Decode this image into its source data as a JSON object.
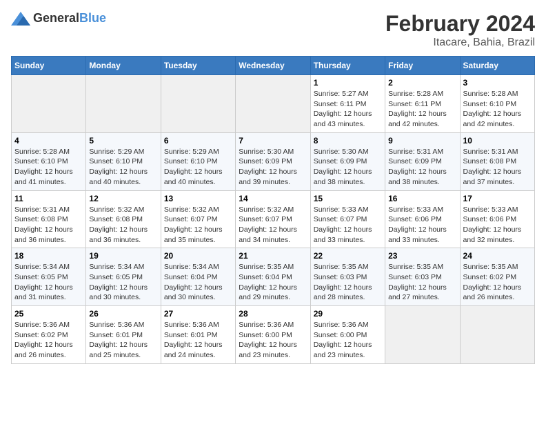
{
  "logo": {
    "general": "General",
    "blue": "Blue"
  },
  "title": "February 2024",
  "location": "Itacare, Bahia, Brazil",
  "days_of_week": [
    "Sunday",
    "Monday",
    "Tuesday",
    "Wednesday",
    "Thursday",
    "Friday",
    "Saturday"
  ],
  "weeks": [
    [
      {
        "day": "",
        "info": ""
      },
      {
        "day": "",
        "info": ""
      },
      {
        "day": "",
        "info": ""
      },
      {
        "day": "",
        "info": ""
      },
      {
        "day": "1",
        "info": "Sunrise: 5:27 AM\nSunset: 6:11 PM\nDaylight: 12 hours and 43 minutes."
      },
      {
        "day": "2",
        "info": "Sunrise: 5:28 AM\nSunset: 6:11 PM\nDaylight: 12 hours and 42 minutes."
      },
      {
        "day": "3",
        "info": "Sunrise: 5:28 AM\nSunset: 6:10 PM\nDaylight: 12 hours and 42 minutes."
      }
    ],
    [
      {
        "day": "4",
        "info": "Sunrise: 5:28 AM\nSunset: 6:10 PM\nDaylight: 12 hours and 41 minutes."
      },
      {
        "day": "5",
        "info": "Sunrise: 5:29 AM\nSunset: 6:10 PM\nDaylight: 12 hours and 40 minutes."
      },
      {
        "day": "6",
        "info": "Sunrise: 5:29 AM\nSunset: 6:10 PM\nDaylight: 12 hours and 40 minutes."
      },
      {
        "day": "7",
        "info": "Sunrise: 5:30 AM\nSunset: 6:09 PM\nDaylight: 12 hours and 39 minutes."
      },
      {
        "day": "8",
        "info": "Sunrise: 5:30 AM\nSunset: 6:09 PM\nDaylight: 12 hours and 38 minutes."
      },
      {
        "day": "9",
        "info": "Sunrise: 5:31 AM\nSunset: 6:09 PM\nDaylight: 12 hours and 38 minutes."
      },
      {
        "day": "10",
        "info": "Sunrise: 5:31 AM\nSunset: 6:08 PM\nDaylight: 12 hours and 37 minutes."
      }
    ],
    [
      {
        "day": "11",
        "info": "Sunrise: 5:31 AM\nSunset: 6:08 PM\nDaylight: 12 hours and 36 minutes."
      },
      {
        "day": "12",
        "info": "Sunrise: 5:32 AM\nSunset: 6:08 PM\nDaylight: 12 hours and 36 minutes."
      },
      {
        "day": "13",
        "info": "Sunrise: 5:32 AM\nSunset: 6:07 PM\nDaylight: 12 hours and 35 minutes."
      },
      {
        "day": "14",
        "info": "Sunrise: 5:32 AM\nSunset: 6:07 PM\nDaylight: 12 hours and 34 minutes."
      },
      {
        "day": "15",
        "info": "Sunrise: 5:33 AM\nSunset: 6:07 PM\nDaylight: 12 hours and 33 minutes."
      },
      {
        "day": "16",
        "info": "Sunrise: 5:33 AM\nSunset: 6:06 PM\nDaylight: 12 hours and 33 minutes."
      },
      {
        "day": "17",
        "info": "Sunrise: 5:33 AM\nSunset: 6:06 PM\nDaylight: 12 hours and 32 minutes."
      }
    ],
    [
      {
        "day": "18",
        "info": "Sunrise: 5:34 AM\nSunset: 6:05 PM\nDaylight: 12 hours and 31 minutes."
      },
      {
        "day": "19",
        "info": "Sunrise: 5:34 AM\nSunset: 6:05 PM\nDaylight: 12 hours and 30 minutes."
      },
      {
        "day": "20",
        "info": "Sunrise: 5:34 AM\nSunset: 6:04 PM\nDaylight: 12 hours and 30 minutes."
      },
      {
        "day": "21",
        "info": "Sunrise: 5:35 AM\nSunset: 6:04 PM\nDaylight: 12 hours and 29 minutes."
      },
      {
        "day": "22",
        "info": "Sunrise: 5:35 AM\nSunset: 6:03 PM\nDaylight: 12 hours and 28 minutes."
      },
      {
        "day": "23",
        "info": "Sunrise: 5:35 AM\nSunset: 6:03 PM\nDaylight: 12 hours and 27 minutes."
      },
      {
        "day": "24",
        "info": "Sunrise: 5:35 AM\nSunset: 6:02 PM\nDaylight: 12 hours and 26 minutes."
      }
    ],
    [
      {
        "day": "25",
        "info": "Sunrise: 5:36 AM\nSunset: 6:02 PM\nDaylight: 12 hours and 26 minutes."
      },
      {
        "day": "26",
        "info": "Sunrise: 5:36 AM\nSunset: 6:01 PM\nDaylight: 12 hours and 25 minutes."
      },
      {
        "day": "27",
        "info": "Sunrise: 5:36 AM\nSunset: 6:01 PM\nDaylight: 12 hours and 24 minutes."
      },
      {
        "day": "28",
        "info": "Sunrise: 5:36 AM\nSunset: 6:00 PM\nDaylight: 12 hours and 23 minutes."
      },
      {
        "day": "29",
        "info": "Sunrise: 5:36 AM\nSunset: 6:00 PM\nDaylight: 12 hours and 23 minutes."
      },
      {
        "day": "",
        "info": ""
      },
      {
        "day": "",
        "info": ""
      }
    ]
  ]
}
